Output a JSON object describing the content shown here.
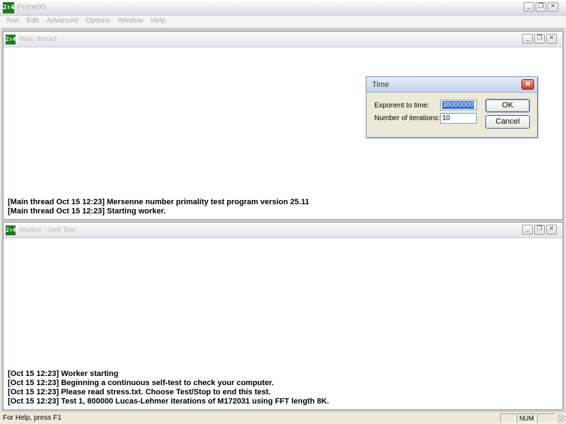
{
  "app": {
    "title": "Prime95",
    "icon_text": "2↑4"
  },
  "menu": [
    "Test",
    "Edit",
    "Advanced",
    "Options",
    "Window",
    "Help"
  ],
  "main_thread": {
    "title": "Main thread",
    "log": [
      "[Main thread Oct 15 12:23] Mersenne number primality test program version 25.11",
      "[Main thread Oct 15 12:23] Starting worker."
    ]
  },
  "worker": {
    "title": "Worker - Self-Test",
    "log": [
      "[Oct 15 12:23] Worker starting",
      "[Oct 15 12:23] Beginning a continuous self-test to check your computer.",
      "[Oct 15 12:23] Please read stress.txt.  Choose Test/Stop to end this test.",
      "[Oct 15 12:23] Test 1, 800000 Lucas-Lehmer iterations of M172031 using FFT length 8K."
    ]
  },
  "dialog": {
    "title": "Time",
    "exponent_label": "Exponent to time:",
    "exponent_value": "38000000",
    "iterations_label": "Number of iterations:",
    "iterations_value": "10",
    "ok_label": "OK",
    "cancel_label": "Cancel"
  },
  "status": {
    "help_text": "For Help, press F1",
    "num_label": "NUM"
  },
  "icons": {
    "minimize": "minimize-icon",
    "restore": "restore-icon",
    "close": "close-icon"
  },
  "colors": {
    "icon_green": "#1e7a1e",
    "selection_blue": "#316ac5",
    "close_red": "#c0452a"
  }
}
